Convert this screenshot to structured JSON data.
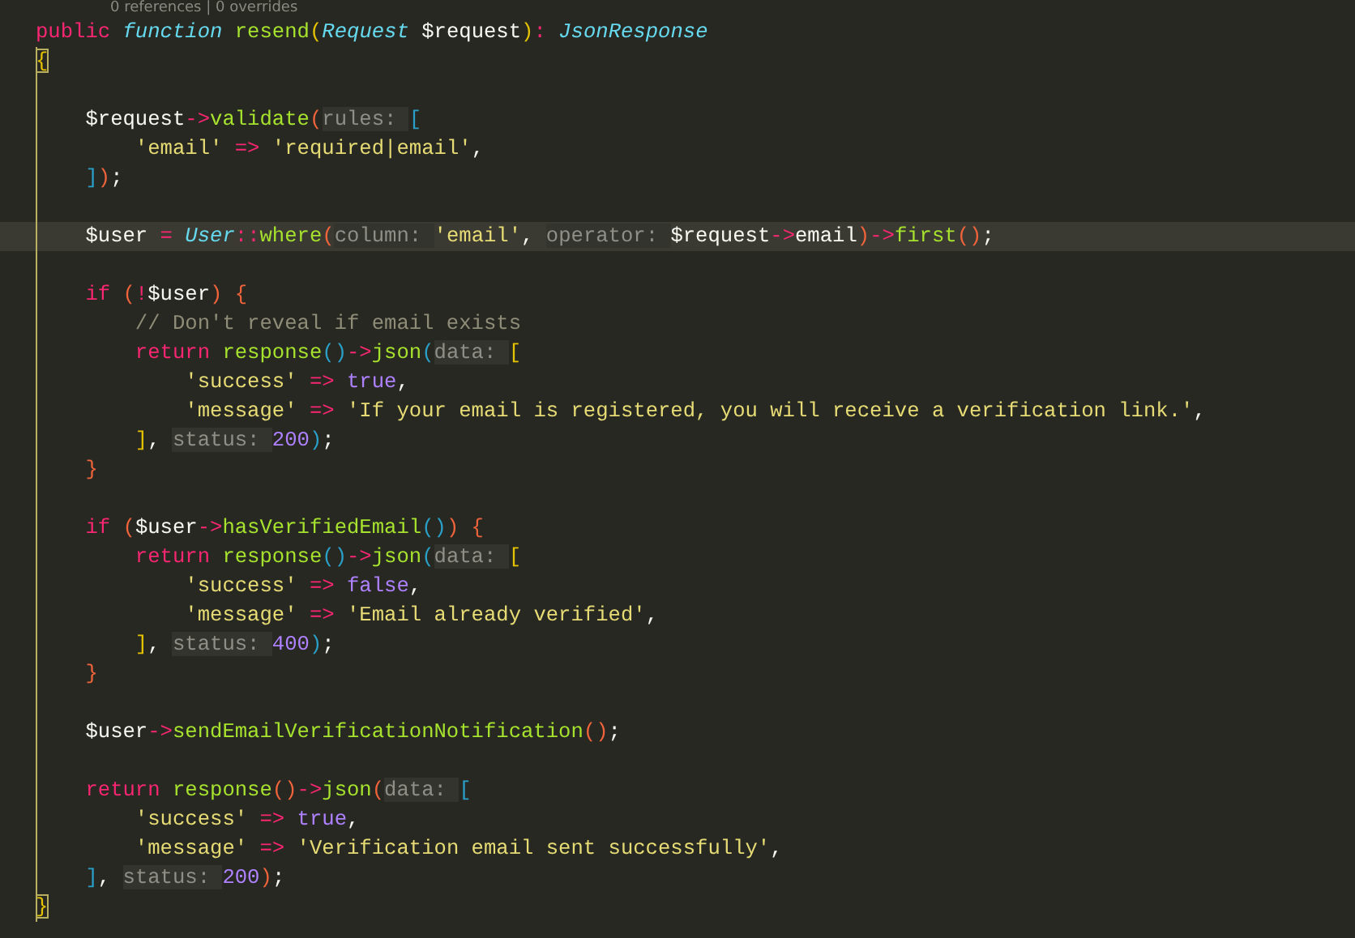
{
  "codelens": "0 references | 0 overrides",
  "lines": [
    {
      "current": false,
      "tokens": [
        {
          "text": "public",
          "kind": "keyword"
        },
        {
          "text": " function",
          "kind": "storage"
        },
        {
          "text": " resend",
          "kind": "function"
        },
        {
          "text": "(",
          "kind": "bracket1"
        },
        {
          "text": "Request",
          "kind": "type"
        },
        {
          "text": " $request",
          "kind": "plain"
        },
        {
          "text": ")",
          "kind": "bracket1"
        },
        {
          "text": ":",
          "kind": "operator"
        },
        {
          "text": " JsonResponse",
          "kind": "type"
        }
      ]
    },
    {
      "current": false,
      "tokens": [
        {
          "text": "{",
          "kind": "match"
        }
      ]
    },
    {
      "current": false
    },
    {
      "current": false,
      "tokens": [
        {
          "text": "    $request",
          "kind": "plain"
        },
        {
          "text": "->",
          "kind": "operator"
        },
        {
          "text": "validate",
          "kind": "function"
        },
        {
          "text": "(",
          "kind": "bracket2"
        },
        {
          "text": "rules:",
          "kind": "hint"
        },
        {
          "text": "[",
          "kind": "bracket3"
        }
      ]
    },
    {
      "current": false,
      "tokens": [
        {
          "text": "        'email'",
          "kind": "string"
        },
        {
          "text": " =>",
          "kind": "operator"
        },
        {
          "text": " 'required|email'",
          "kind": "string"
        },
        {
          "text": ",",
          "kind": "plain"
        }
      ]
    },
    {
      "current": false,
      "tokens": [
        {
          "text": "    ]",
          "kind": "bracket3"
        },
        {
          "text": ")",
          "kind": "bracket2"
        },
        {
          "text": ";",
          "kind": "plain"
        }
      ]
    },
    {
      "current": false
    },
    {
      "current": true,
      "tokens": [
        {
          "text": "    $user",
          "kind": "plain"
        },
        {
          "text": " =",
          "kind": "operator"
        },
        {
          "text": " User",
          "kind": "type"
        },
        {
          "text": "::",
          "kind": "operator"
        },
        {
          "text": "where",
          "kind": "function"
        },
        {
          "text": "(",
          "kind": "bracket2"
        },
        {
          "text": "column:",
          "kind": "hint"
        },
        {
          "text": "'email'",
          "kind": "string"
        },
        {
          "text": ",",
          "kind": "plain"
        },
        {
          "text": "operator:",
          "kind": "hint"
        },
        {
          "text": "$request",
          "kind": "plain"
        },
        {
          "text": "->",
          "kind": "operator"
        },
        {
          "text": "email",
          "kind": "plain"
        },
        {
          "text": ")",
          "kind": "bracket2"
        },
        {
          "text": "->",
          "kind": "operator"
        },
        {
          "text": "first",
          "kind": "function"
        },
        {
          "text": "()",
          "kind": "bracket2"
        },
        {
          "text": ";",
          "kind": "plain"
        }
      ]
    },
    {
      "current": false
    },
    {
      "current": false,
      "tokens": [
        {
          "text": "    if",
          "kind": "keyword"
        },
        {
          "text": " (",
          "kind": "bracket2"
        },
        {
          "text": "!",
          "kind": "operator"
        },
        {
          "text": "$user",
          "kind": "plain"
        },
        {
          "text": ")",
          "kind": "bracket2"
        },
        {
          "text": " {",
          "kind": "bracket2"
        }
      ]
    },
    {
      "current": false,
      "tokens": [
        {
          "text": "        // Don't reveal if email exists",
          "kind": "comment"
        }
      ]
    },
    {
      "current": false,
      "tokens": [
        {
          "text": "        return",
          "kind": "keyword"
        },
        {
          "text": " response",
          "kind": "function"
        },
        {
          "text": "()",
          "kind": "bracket3"
        },
        {
          "text": "->",
          "kind": "operator"
        },
        {
          "text": "json",
          "kind": "function"
        },
        {
          "text": "(",
          "kind": "bracket3"
        },
        {
          "text": "data:",
          "kind": "hint"
        },
        {
          "text": "[",
          "kind": "bracket1"
        }
      ]
    },
    {
      "current": false,
      "tokens": [
        {
          "text": "            'success'",
          "kind": "string"
        },
        {
          "text": " =>",
          "kind": "operator"
        },
        {
          "text": " true",
          "kind": "constant"
        },
        {
          "text": ",",
          "kind": "plain"
        }
      ]
    },
    {
      "current": false,
      "tokens": [
        {
          "text": "            'message'",
          "kind": "string"
        },
        {
          "text": " =>",
          "kind": "operator"
        },
        {
          "text": " 'If your email is registered, you will receive a verification link.'",
          "kind": "string"
        },
        {
          "text": ",",
          "kind": "plain"
        }
      ]
    },
    {
      "current": false,
      "tokens": [
        {
          "text": "        ]",
          "kind": "bracket1"
        },
        {
          "text": ",",
          "kind": "plain"
        },
        {
          "text": "status:",
          "kind": "hint"
        },
        {
          "text": "200",
          "kind": "constant"
        },
        {
          "text": ")",
          "kind": "bracket3"
        },
        {
          "text": ";",
          "kind": "plain"
        }
      ]
    },
    {
      "current": false,
      "tokens": [
        {
          "text": "    }",
          "kind": "bracket2"
        }
      ]
    },
    {
      "current": false
    },
    {
      "current": false,
      "tokens": [
        {
          "text": "    if",
          "kind": "keyword"
        },
        {
          "text": " (",
          "kind": "bracket2"
        },
        {
          "text": "$user",
          "kind": "plain"
        },
        {
          "text": "->",
          "kind": "operator"
        },
        {
          "text": "hasVerifiedEmail",
          "kind": "function"
        },
        {
          "text": "()",
          "kind": "bracket3"
        },
        {
          "text": ")",
          "kind": "bracket2"
        },
        {
          "text": " {",
          "kind": "bracket2"
        }
      ]
    },
    {
      "current": false,
      "tokens": [
        {
          "text": "        return",
          "kind": "keyword"
        },
        {
          "text": " response",
          "kind": "function"
        },
        {
          "text": "()",
          "kind": "bracket3"
        },
        {
          "text": "->",
          "kind": "operator"
        },
        {
          "text": "json",
          "kind": "function"
        },
        {
          "text": "(",
          "kind": "bracket3"
        },
        {
          "text": "data:",
          "kind": "hint"
        },
        {
          "text": "[",
          "kind": "bracket1"
        }
      ]
    },
    {
      "current": false,
      "tokens": [
        {
          "text": "            'success'",
          "kind": "string"
        },
        {
          "text": " =>",
          "kind": "operator"
        },
        {
          "text": " false",
          "kind": "constant"
        },
        {
          "text": ",",
          "kind": "plain"
        }
      ]
    },
    {
      "current": false,
      "tokens": [
        {
          "text": "            'message'",
          "kind": "string"
        },
        {
          "text": " =>",
          "kind": "operator"
        },
        {
          "text": " 'Email already verified'",
          "kind": "string"
        },
        {
          "text": ",",
          "kind": "plain"
        }
      ]
    },
    {
      "current": false,
      "tokens": [
        {
          "text": "        ]",
          "kind": "bracket1"
        },
        {
          "text": ",",
          "kind": "plain"
        },
        {
          "text": "status:",
          "kind": "hint"
        },
        {
          "text": "400",
          "kind": "constant"
        },
        {
          "text": ")",
          "kind": "bracket3"
        },
        {
          "text": ";",
          "kind": "plain"
        }
      ]
    },
    {
      "current": false,
      "tokens": [
        {
          "text": "    }",
          "kind": "bracket2"
        }
      ]
    },
    {
      "current": false
    },
    {
      "current": false,
      "tokens": [
        {
          "text": "    $user",
          "kind": "plain"
        },
        {
          "text": "->",
          "kind": "operator"
        },
        {
          "text": "sendEmailVerificationNotification",
          "kind": "function"
        },
        {
          "text": "()",
          "kind": "bracket2"
        },
        {
          "text": ";",
          "kind": "plain"
        }
      ]
    },
    {
      "current": false
    },
    {
      "current": false,
      "tokens": [
        {
          "text": "    return",
          "kind": "keyword"
        },
        {
          "text": " response",
          "kind": "function"
        },
        {
          "text": "()",
          "kind": "bracket2"
        },
        {
          "text": "->",
          "kind": "operator"
        },
        {
          "text": "json",
          "kind": "function"
        },
        {
          "text": "(",
          "kind": "bracket2"
        },
        {
          "text": "data:",
          "kind": "hint"
        },
        {
          "text": "[",
          "kind": "bracket3"
        }
      ]
    },
    {
      "current": false,
      "tokens": [
        {
          "text": "        'success'",
          "kind": "string"
        },
        {
          "text": " =>",
          "kind": "operator"
        },
        {
          "text": " true",
          "kind": "constant"
        },
        {
          "text": ",",
          "kind": "plain"
        }
      ]
    },
    {
      "current": false,
      "tokens": [
        {
          "text": "        'message'",
          "kind": "string"
        },
        {
          "text": " =>",
          "kind": "operator"
        },
        {
          "text": " 'Verification email sent successfully'",
          "kind": "string"
        },
        {
          "text": ",",
          "kind": "plain"
        }
      ]
    },
    {
      "current": false,
      "tokens": [
        {
          "text": "    ]",
          "kind": "bracket3"
        },
        {
          "text": ",",
          "kind": "plain"
        },
        {
          "text": "status:",
          "kind": "hint"
        },
        {
          "text": "200",
          "kind": "constant"
        },
        {
          "text": ")",
          "kind": "bracket2"
        },
        {
          "text": ";",
          "kind": "plain"
        }
      ]
    },
    {
      "current": false,
      "tokens": [
        {
          "text": "}",
          "kind": "match"
        }
      ]
    }
  ]
}
